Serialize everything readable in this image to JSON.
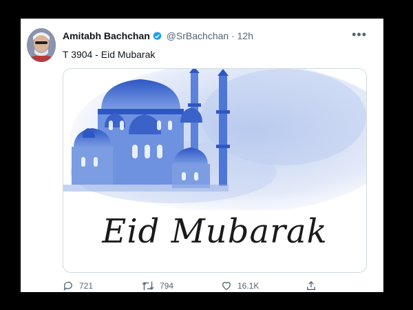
{
  "tweet": {
    "author_name": "Amitabh Bachchan",
    "handle": "@SrBachchan",
    "separator": "·",
    "time": "12h",
    "text": "T 3904 - Eid Mubarak",
    "more_icon": "more-horizontal-icon",
    "verified_icon": "verified-badge-icon"
  },
  "media": {
    "greeting": "Eid Mubarak",
    "main_color": "#4a70d0"
  },
  "actions": {
    "reply_count": "721",
    "retweet_count": "794",
    "like_count": "16.1K",
    "share_icon": "share-icon"
  }
}
